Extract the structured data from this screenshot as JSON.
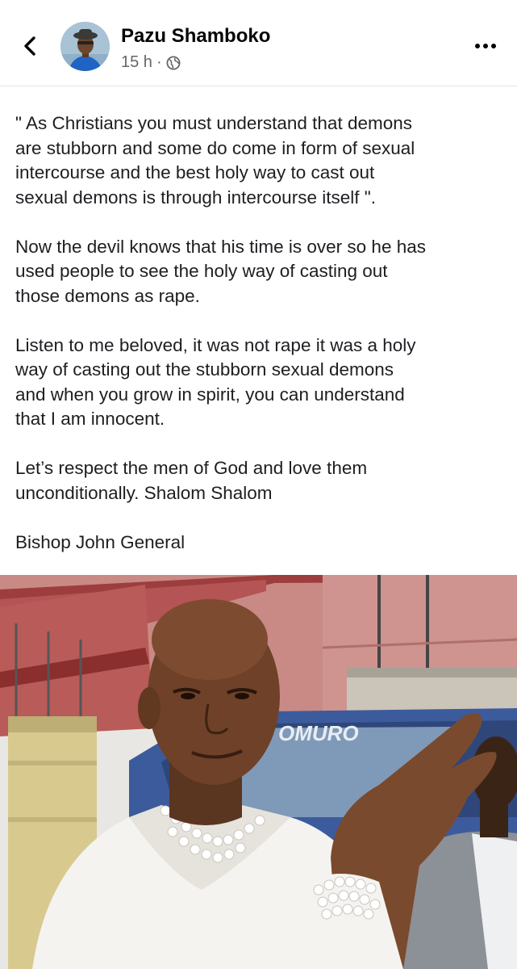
{
  "header": {
    "back_icon": "chevron-left-icon",
    "author_name": "Pazu Shamboko",
    "time": "15 h",
    "separator": "·",
    "audience_icon": "globe-icon",
    "more_icon": "more-horizontal-icon"
  },
  "post": {
    "paragraphs": [
      "\" As Christians you must understand that demons\nare stubborn and some do come in form of sexual\nintercourse and the best holy way to cast out\nsexual demons is through intercourse itself \".",
      "Now the devil knows that his time is over so he has\nused people to see the holy way of casting out\nthose demons as rape.",
      "Listen to me beloved, it was not rape it was a holy\nway of casting out the stubborn sexual demons\nand when you grow in spirit, you can understand\nthat I am innocent.",
      "Let’s respect the men of God and love them\nunconditionally. Shalom Shalom",
      "Bishop John General"
    ]
  },
  "photo": {
    "vehicle_lettering": "OMURO"
  },
  "colors": {
    "name": "#050505",
    "meta": "#65676b",
    "body_text": "#1c1e21",
    "divider": "#e4e6eb"
  }
}
